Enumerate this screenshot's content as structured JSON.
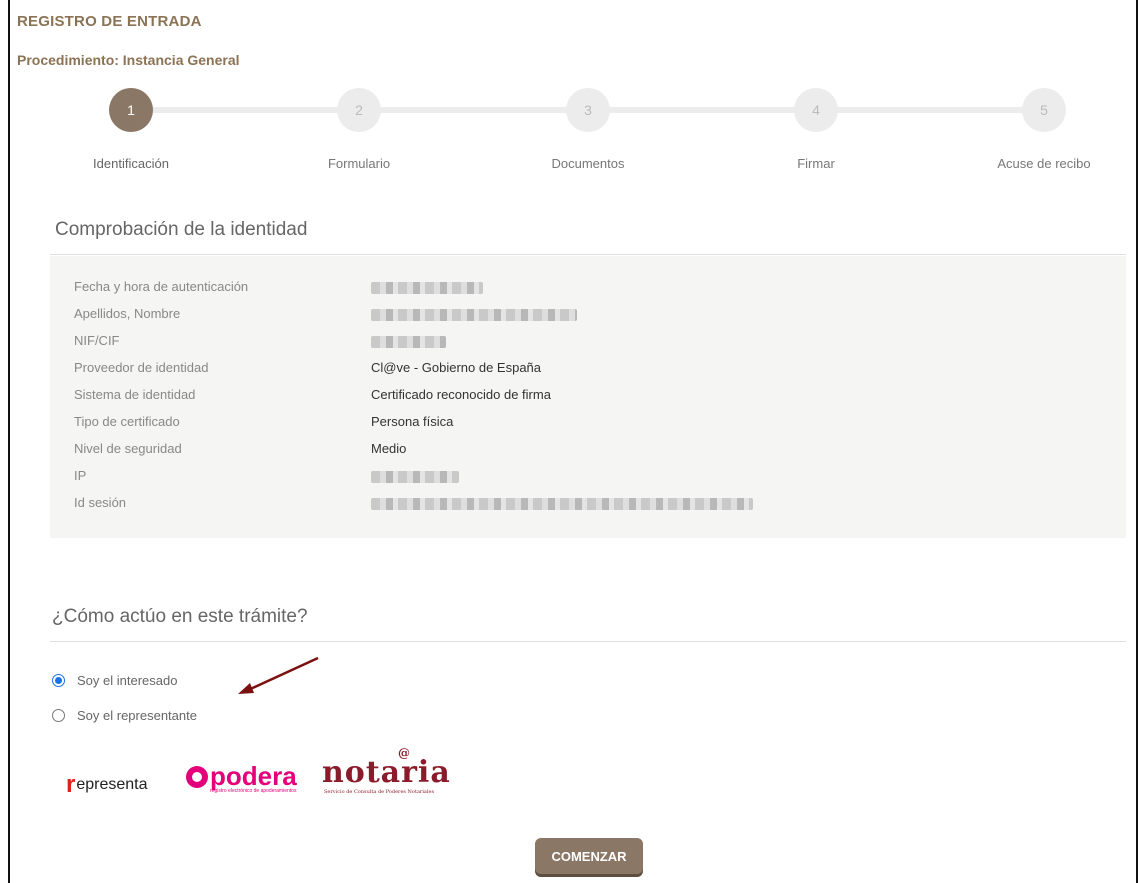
{
  "header": {
    "title": "REGISTRO DE ENTRADA",
    "procedure": "Procedimiento: Instancia General"
  },
  "steps": [
    {
      "number": "1",
      "label": "Identificación",
      "active": true
    },
    {
      "number": "2",
      "label": "Formulario",
      "active": false
    },
    {
      "number": "3",
      "label": "Documentos",
      "active": false
    },
    {
      "number": "4",
      "label": "Firmar",
      "active": false
    },
    {
      "number": "5",
      "label": "Acuse de recibo",
      "active": false
    }
  ],
  "identity": {
    "title": "Comprobación de la identidad",
    "rows": [
      {
        "label": "Fecha y hora de autenticación",
        "value": ""
      },
      {
        "label": "Apellidos, Nombre",
        "value": ""
      },
      {
        "label": "NIF/CIF",
        "value": ""
      },
      {
        "label": "Proveedor de identidad",
        "value": "Cl@ve - Gobierno de España"
      },
      {
        "label": "Sistema de identidad",
        "value": "Certificado reconocido de firma"
      },
      {
        "label": "Tipo de certificado",
        "value": "Persona física"
      },
      {
        "label": "Nivel de seguridad",
        "value": "Medio"
      },
      {
        "label": "IP",
        "value": ""
      },
      {
        "label": "Id sesión",
        "value": ""
      }
    ]
  },
  "role": {
    "title": "¿Cómo actúo en este trámite?",
    "options": [
      {
        "label": "Soy el interesado",
        "checked": true
      },
      {
        "label": "Soy el representante",
        "checked": false
      }
    ]
  },
  "logos": {
    "represents": {
      "mark": "r",
      "text": "epresenta"
    },
    "apodera": {
      "text": "podera",
      "sub": "registro electrónico de apoderamientos"
    },
    "notaria": {
      "text": "notaria",
      "at": "@",
      "sub": "Servicio de Consulta de Poderes Notariales"
    }
  },
  "actions": {
    "start_label": "COMENZAR"
  },
  "colors": {
    "brand": "#8b7765",
    "radio_accent": "#1a73e8",
    "arrow": "#7a1010"
  }
}
